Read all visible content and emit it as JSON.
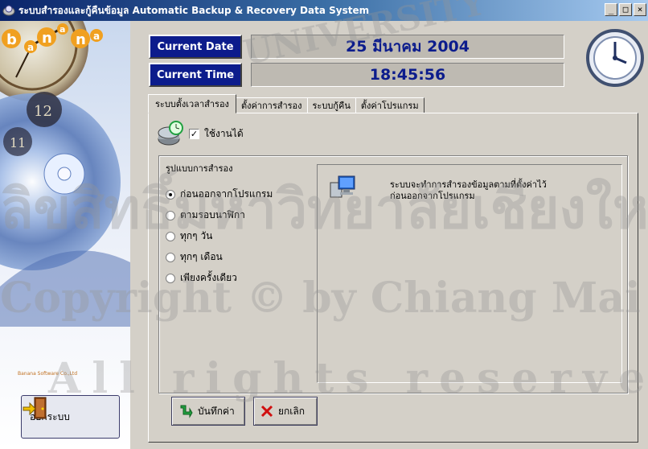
{
  "window": {
    "title": "ระบบสำรองและกู้คืนข้อมูล  Automatic Backup & Recovery Data System",
    "minimize": "_",
    "maximize": "□",
    "close": "×"
  },
  "header": {
    "date_label": "Current Date",
    "date_value": "25 มีนาคม 2004",
    "time_label": "Current Time",
    "time_value": "18:45:56"
  },
  "tabs": [
    {
      "label": "ระบบตั้งเวลาสำรอง",
      "active": true
    },
    {
      "label": "ตั้งค่าการสำรอง",
      "active": false
    },
    {
      "label": "ระบบกู้คืน",
      "active": false
    },
    {
      "label": "ตั้งค่าโปรแกรม",
      "active": false
    }
  ],
  "schedule": {
    "enable_label": "ใช้งานได้",
    "enabled": true,
    "group_title": "รูปแบบการสำรอง",
    "options": [
      {
        "label": "ก่อนออกจากโปรแกรม",
        "selected": true
      },
      {
        "label": "ตามรอบนาฬิกา",
        "selected": false
      },
      {
        "label": "ทุกๆ วัน",
        "selected": false
      },
      {
        "label": "ทุกๆ เดือน",
        "selected": false
      },
      {
        "label": "เพียงครั้งเดียว",
        "selected": false
      }
    ],
    "description_line1": "ระบบจะทำการสำรองข้อมูลตามที่ตั้งค่าไว้",
    "description_line2": "ก่อนออกจากโปรแกรม"
  },
  "buttons": {
    "save": "บันทึกค่า",
    "cancel": "ยกเลิก",
    "exit": "ออกระบบ"
  },
  "logo": {
    "letters": [
      "b",
      "a",
      "n",
      "a",
      "n",
      "a"
    ],
    "caption": "Banana Software Co.,Ltd"
  },
  "watermark": {
    "line1": "UNIVERSITY",
    "line2": "ลิขสิทธิ์มหาวิทยาลัยเชียงใหม่",
    "line3": "Copyright © by Chiang Mai University",
    "line4": "All rights reserved"
  },
  "colors": {
    "label_bg": "#0c1c8c",
    "value_text": "#0c1c8c",
    "logo_orange": "#f0a020"
  },
  "icons": [
    "app-icon",
    "clock-icon",
    "disk-clock-icon",
    "computer-icon",
    "save-arrow-icon",
    "cancel-x-icon",
    "exit-door-icon"
  ]
}
